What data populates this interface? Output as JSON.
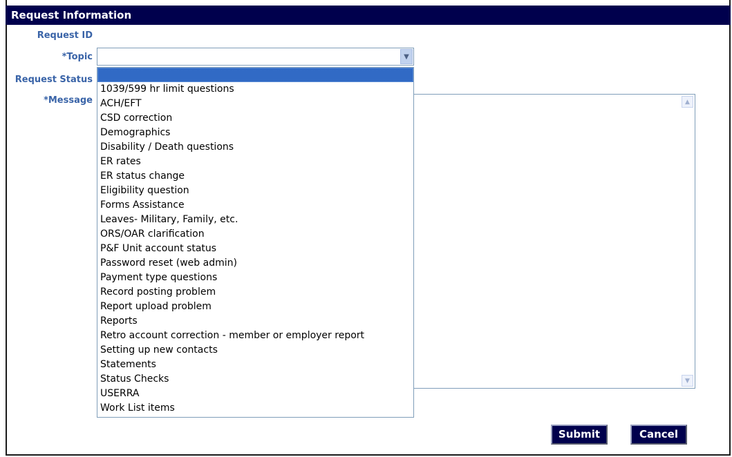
{
  "header": {
    "title": "Request Information"
  },
  "labels": {
    "request_id": "Request ID",
    "topic": "*Topic",
    "request_status": "Request Status",
    "message": "*Message"
  },
  "topic_select": {
    "selected_value": "",
    "options": [
      "1039/599 hr limit questions",
      "ACH/EFT",
      "CSD correction",
      "Demographics",
      "Disability / Death questions",
      "ER rates",
      "ER status change",
      "Eligibility question",
      "Forms Assistance",
      "Leaves- Military, Family, etc.",
      "ORS/OAR clarification",
      "P&F Unit account status",
      "Password reset (web admin)",
      "Payment type questions",
      "Record posting problem",
      "Report upload problem",
      "Reports",
      "Retro account correction - member or employer report",
      "Setting up new contacts",
      "Statements",
      "Status Checks",
      "USERRA",
      "Work List items"
    ]
  },
  "buttons": {
    "submit": "Submit",
    "cancel": "Cancel"
  },
  "colors": {
    "header_bg": "#00004d",
    "label": "#3a64a8",
    "highlight": "#316ac5"
  }
}
